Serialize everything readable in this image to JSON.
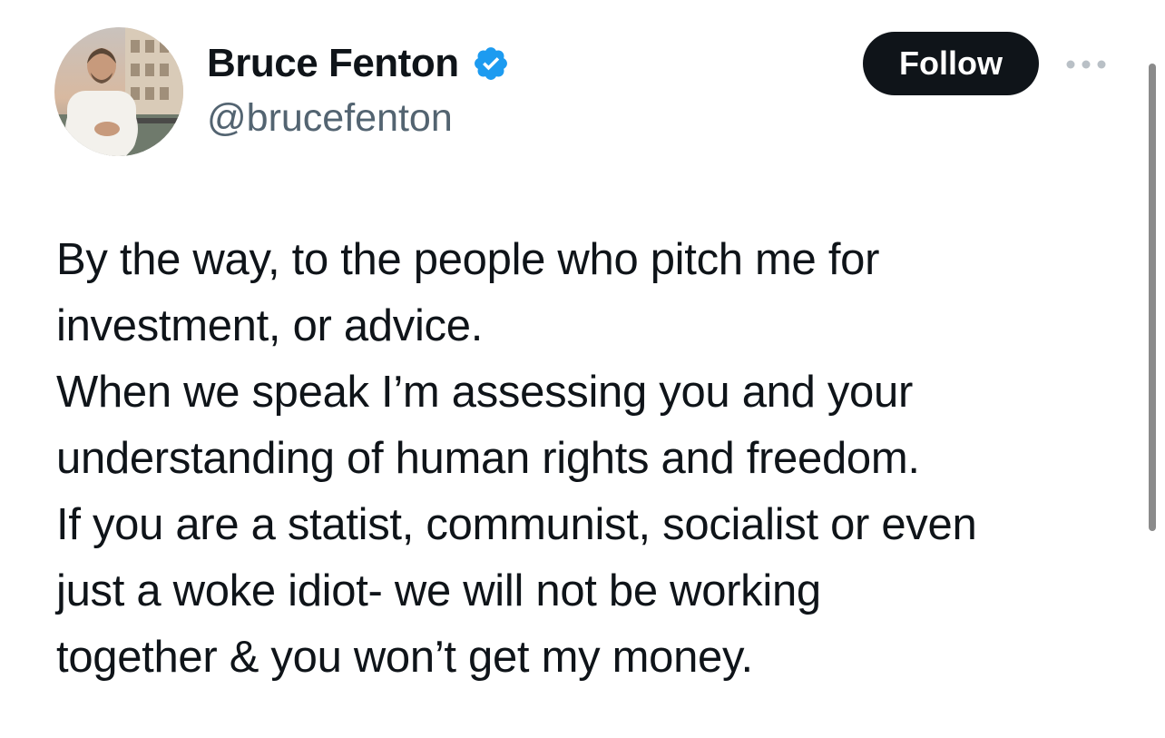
{
  "author": {
    "display_name": "Bruce Fenton",
    "handle": "@brucefenton",
    "verified_icon": "verified-badge-icon",
    "verified_color": "#1d9bf0"
  },
  "actions": {
    "follow_label": "Follow",
    "more_icon": "more-dots-icon"
  },
  "tweet": {
    "lines": [
      "By the way, to the people who pitch me for",
      "investment, or advice.",
      "When we speak I’m assessing you and your",
      "understanding of human rights and freedom.",
      "If you are a statist, communist, socialist or even",
      "just a woke idiot- we will not be working",
      "together & you won’t get my money."
    ]
  },
  "colors": {
    "text": "#0f1419",
    "secondary_text": "#536471",
    "follow_bg": "#0f1419",
    "follow_text": "#ffffff"
  }
}
